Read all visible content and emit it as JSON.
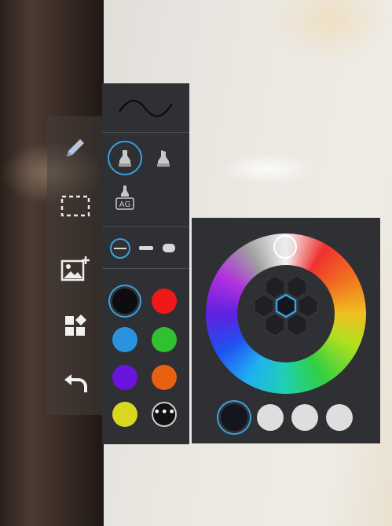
{
  "toolbar": {
    "tools": [
      {
        "name": "pen",
        "icon": "pen-icon"
      },
      {
        "name": "select",
        "icon": "dashed-selection-icon"
      },
      {
        "name": "add-image",
        "icon": "add-image-icon"
      },
      {
        "name": "shapes",
        "icon": "shapes-icon"
      },
      {
        "name": "undo",
        "icon": "undo-icon"
      }
    ]
  },
  "pen_panel": {
    "pen_types": [
      {
        "name": "marker",
        "icon": "marker-icon",
        "selected": true
      },
      {
        "name": "highlighter",
        "icon": "highlighter-icon",
        "selected": false
      },
      {
        "name": "handwriting-recognition",
        "icon": "text-recognition-pen-icon",
        "selected": false
      }
    ],
    "pen_type_badge": "AG",
    "thickness_options": [
      "thin",
      "medium",
      "thick"
    ],
    "selected_thickness": "thin",
    "colors": [
      "#0d0d10",
      "#f01818",
      "#2a93de",
      "#30c030",
      "#6a14e0",
      "#e86010",
      "#d8d820"
    ],
    "selected_color": "#0d0d10",
    "more_colors_label": "•••"
  },
  "color_picker": {
    "hex_colors": [
      "#1f1f24",
      "#1f1f24",
      "#1f1f24",
      "#1f1f24",
      "#1f1f24",
      "#1f1f24",
      "#1f1f24"
    ],
    "selected_hex": 3,
    "recent_colors": [
      "#15151c",
      "#dedede",
      "#dedede",
      "#dedede"
    ],
    "selected_recent": 0,
    "accent": "#3aa0e0"
  }
}
